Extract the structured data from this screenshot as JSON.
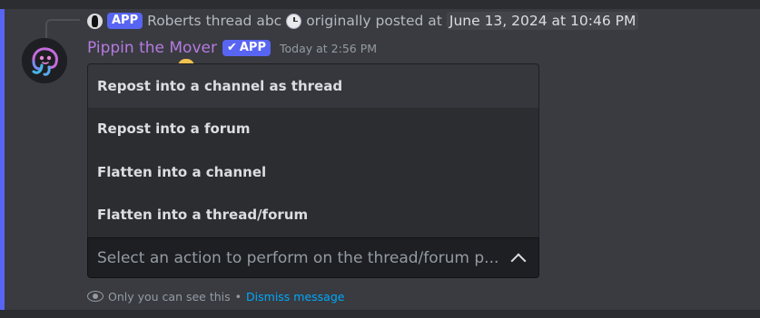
{
  "reply": {
    "app_tag": "APP",
    "author": "Roberts",
    "thread_name": "thread abc",
    "originally_posted": "originally posted at",
    "date": "June 13, 2024 at 10:46 PM"
  },
  "message": {
    "username": "Pippin the Mover",
    "app_tag": "APP",
    "verified_mark": "✔",
    "timestamp": "Today at 2:56 PM"
  },
  "menu": {
    "items": [
      {
        "label": "Repost into a channel as thread"
      },
      {
        "label": "Repost into a forum"
      },
      {
        "label": "Flatten into a channel"
      },
      {
        "label": "Flatten into a thread/forum"
      }
    ]
  },
  "select": {
    "placeholder": "Select an action to perform on the thread/forum p..."
  },
  "footnote": {
    "visibility": "Only you can see this",
    "separator": " • ",
    "dismiss": "Dismiss message"
  },
  "colors": {
    "background": "#313338",
    "highlight": "#393b40",
    "accent": "#5865f2",
    "username": "#b67ae0",
    "link": "#00a8fc"
  }
}
